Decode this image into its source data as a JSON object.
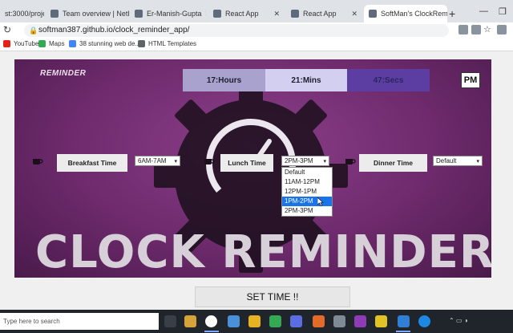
{
  "browser": {
    "tabs": [
      {
        "title": "st:3000/projec"
      },
      {
        "title": "Team overview | Netli"
      },
      {
        "title": "Er-Manish-Gupta"
      },
      {
        "title": "React App"
      },
      {
        "title": "React App"
      },
      {
        "title": "SoftMan's ClockRemin"
      }
    ],
    "new_tab_label": "+",
    "url": "softman387.github.io/clock_reminder_app/",
    "bookmarks": [
      {
        "label": "YouTube",
        "color": "#e62117"
      },
      {
        "label": "Maps",
        "color": "#34a853"
      },
      {
        "label": "38 stunning web de...",
        "color": "#4285f4"
      },
      {
        "label": "HTML Templates",
        "color": "#5f6368"
      }
    ]
  },
  "app": {
    "logo": "REMINDER",
    "clock": {
      "hours": "17:Hours",
      "mins": "21:Mins",
      "secs": "47:Secs"
    },
    "ampm": "PM",
    "meals": {
      "breakfast": {
        "label": "Breakfast Time",
        "value": "6AM-7AM"
      },
      "lunch": {
        "label": "Lunch Time",
        "value": "2PM-3PM"
      },
      "dinner": {
        "label": "Dinner Time",
        "value": "Default"
      }
    },
    "lunch_dropdown": {
      "options": [
        "Default",
        "11AM-12PM",
        "12PM-1PM",
        "1PM-2PM",
        "2PM-3PM"
      ],
      "highlighted": "1PM-2PM"
    },
    "title": "CLOCK REMINDER",
    "set_time_button": "SET TIME !!",
    "colors": {
      "background": "#6d2a6c",
      "hours_cell": "#a9a2cf",
      "mins_cell": "#d3cff0",
      "secs_cell": "#5c3ea3"
    }
  },
  "taskbar": {
    "search_placeholder": "Type here to search"
  }
}
